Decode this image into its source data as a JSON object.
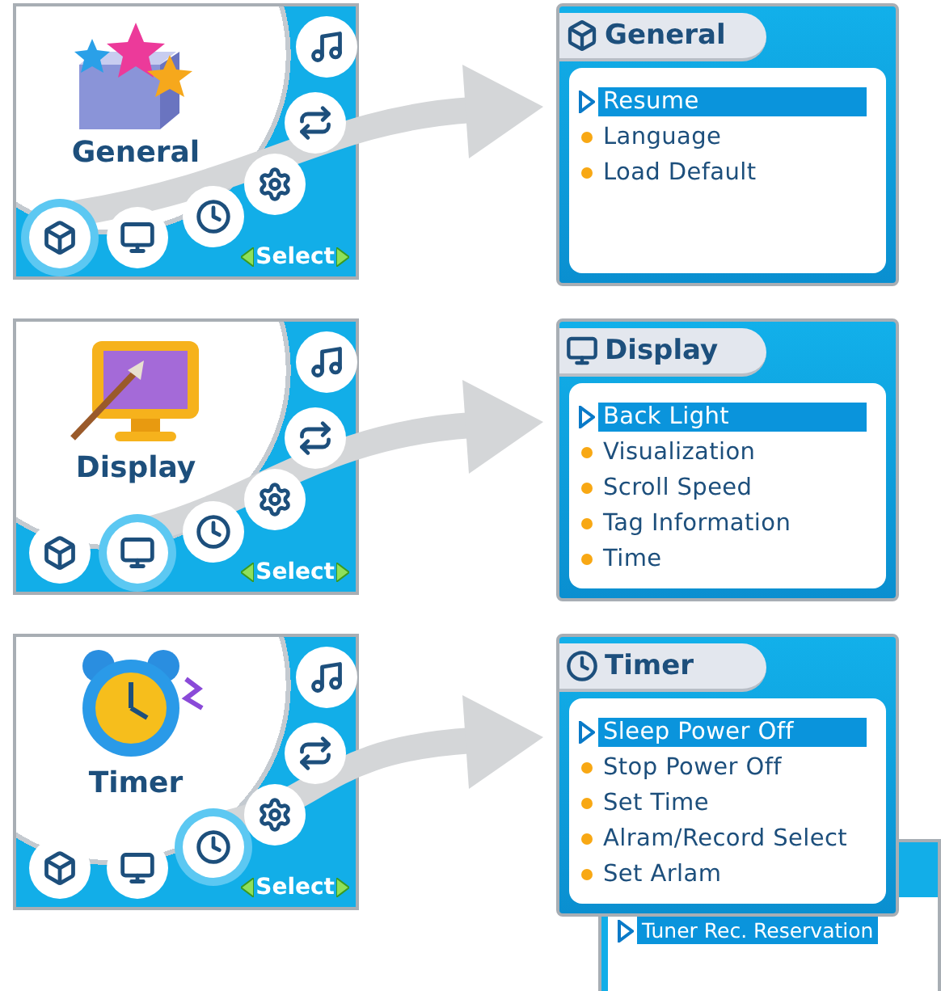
{
  "rows": [
    {
      "menu": {
        "title": "General",
        "icons": [
          {
            "kind": "cube",
            "selected": true
          },
          {
            "kind": "monitor",
            "selected": false
          },
          {
            "kind": "clock",
            "selected": false
          },
          {
            "kind": "gear",
            "selected": false
          },
          {
            "kind": "repeat",
            "selected": false
          },
          {
            "kind": "note",
            "selected": false
          }
        ],
        "select_label": "Select"
      },
      "submenu": {
        "title": "General",
        "items": [
          {
            "label": "Resume",
            "selected": true
          },
          {
            "label": "Language",
            "selected": false
          },
          {
            "label": "Load Default",
            "selected": false
          }
        ]
      }
    },
    {
      "menu": {
        "title": "Display",
        "icons": [
          {
            "kind": "cube",
            "selected": false
          },
          {
            "kind": "monitor",
            "selected": true
          },
          {
            "kind": "clock",
            "selected": false
          },
          {
            "kind": "gear",
            "selected": false
          },
          {
            "kind": "repeat",
            "selected": false
          },
          {
            "kind": "note",
            "selected": false
          }
        ],
        "select_label": "Select"
      },
      "submenu": {
        "title": "Display",
        "items": [
          {
            "label": "Back Light",
            "selected": true
          },
          {
            "label": "Visualization",
            "selected": false
          },
          {
            "label": "Scroll Speed",
            "selected": false
          },
          {
            "label": "Tag Information",
            "selected": false
          },
          {
            "label": "Time",
            "selected": false
          }
        ]
      }
    },
    {
      "menu": {
        "title": "Timer",
        "icons": [
          {
            "kind": "cube",
            "selected": false
          },
          {
            "kind": "monitor",
            "selected": false
          },
          {
            "kind": "clock",
            "selected": true
          },
          {
            "kind": "gear",
            "selected": false
          },
          {
            "kind": "repeat",
            "selected": false
          },
          {
            "kind": "note",
            "selected": false
          }
        ],
        "select_label": "Select"
      },
      "submenu": {
        "title": "Timer",
        "items": [
          {
            "label": "Sleep Power Off",
            "selected": true
          },
          {
            "label": "Stop Power Off",
            "selected": false
          },
          {
            "label": "Set Time",
            "selected": false
          },
          {
            "label": "Alram/Record Select",
            "selected": false
          },
          {
            "label": "Set Arlam",
            "selected": false
          }
        ]
      }
    }
  ],
  "overflow_screen": {
    "items": [
      {
        "label": "Tuner Rec. Reservation",
        "selected": true
      }
    ]
  }
}
